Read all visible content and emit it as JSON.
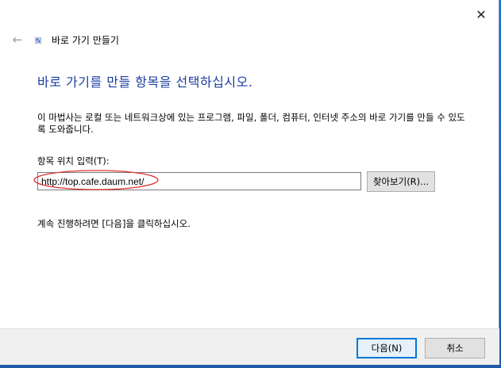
{
  "window": {
    "title": "바로 가기 만들기",
    "close_glyph": "✕",
    "back_glyph": "←"
  },
  "main": {
    "heading": "바로 가기를 만들 항목을 선택하십시오.",
    "description": "이 마법사는 로컬 또는 네트워크상에 있는 프로그램, 파일, 폴더, 컴퓨터, 인터넷 주소의 바로 가기를 만들 수 있도록 도와줍니다.",
    "location_label": "항목 위치 입력(T):",
    "location_value": "http://top.cafe.daum.net/",
    "browse_label": "찾아보기(R)...",
    "continue_text": "계속 진행하려면 [다음]을 클릭하십시오."
  },
  "footer": {
    "next_label": "다음(N)",
    "cancel_label": "취소"
  },
  "colors": {
    "heading": "#1a3d9c",
    "highlight": "#e03030",
    "default_button_border": "#0078d7"
  }
}
